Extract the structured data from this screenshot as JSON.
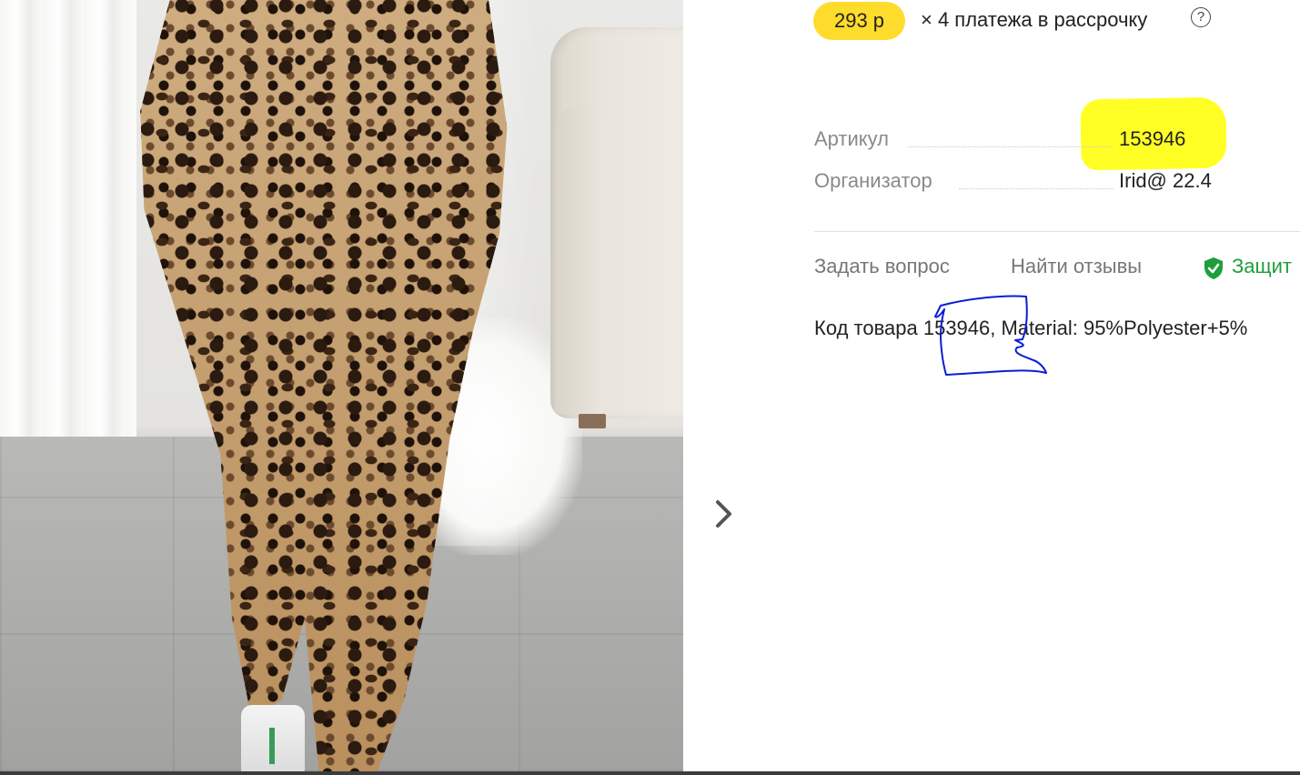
{
  "price": {
    "badge": "293 р",
    "installments_text": "× 4 платежа в рассрочку",
    "help_glyph": "?"
  },
  "specs": [
    {
      "label": "Артикул",
      "value": "153946"
    },
    {
      "label": "Организатор",
      "value": "Irid@ 22.4"
    }
  ],
  "actions": {
    "ask_question": "Задать вопрос",
    "find_reviews": "Найти отзывы",
    "protection": "Защит"
  },
  "description": {
    "prefix": "Код товара ",
    "code": "153946",
    "suffix": ", Material: 95%Polyester+5%"
  },
  "colors": {
    "price_badge": "#fedc2c",
    "highlight": "#ffff26",
    "protection_green": "#1f9e3c",
    "scribble_blue": "#0a1fd6"
  },
  "icons": {
    "next": "chevron-right-icon",
    "help": "question-circle-icon",
    "protect": "shield-check-icon"
  }
}
